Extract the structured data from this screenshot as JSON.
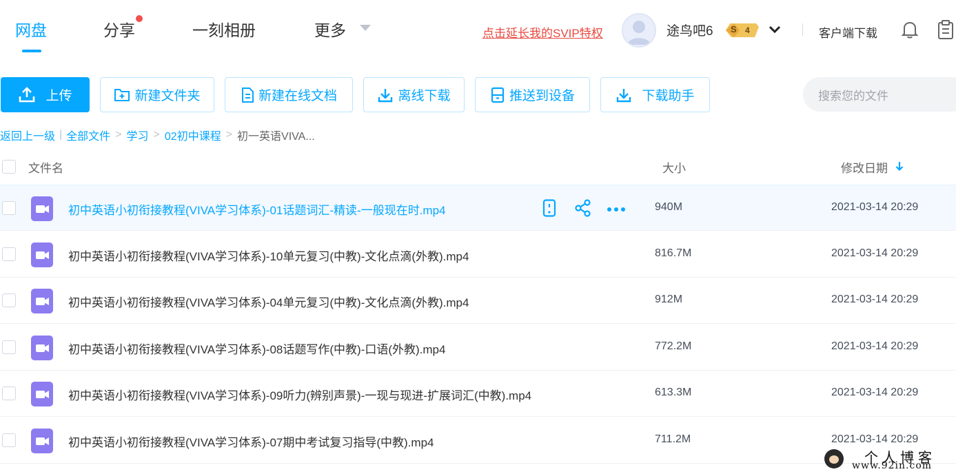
{
  "nav": {
    "tabs": [
      {
        "label": "网盘"
      },
      {
        "label": "分享"
      },
      {
        "label": "一刻相册"
      },
      {
        "label": "更多"
      }
    ]
  },
  "header": {
    "svip_link": "点击延长我的SVIP特权",
    "username": "途鸟吧6",
    "badge_letter": "S",
    "badge_level": "4",
    "client_download": "客户端下载"
  },
  "toolbar": {
    "upload": "上传",
    "new_folder": "新建文件夹",
    "new_doc": "新建在线文档",
    "offline_download": "离线下载",
    "push_device": "推送到设备",
    "download_helper": "下载助手"
  },
  "search": {
    "placeholder": "搜索您的文件"
  },
  "breadcrumb": {
    "back": "返回上一级",
    "items": [
      "全部文件",
      "学习",
      "02初中课程"
    ],
    "current": "初一英语VIVA..."
  },
  "columns": {
    "name": "文件名",
    "size": "大小",
    "date": "修改日期"
  },
  "files": [
    {
      "name": "初中英语小初衔接教程(VIVA学习体系)-01话题词汇-精读-一般现在时.mp4",
      "size": "940M",
      "date": "2021-03-14 20:29"
    },
    {
      "name": "初中英语小初衔接教程(VIVA学习体系)-10单元复习(中教)-文化点滴(外教).mp4",
      "size": "816.7M",
      "date": "2021-03-14 20:29"
    },
    {
      "name": "初中英语小初衔接教程(VIVA学习体系)-04单元复习(中教)-文化点滴(外教).mp4",
      "size": "912M",
      "date": "2021-03-14 20:29"
    },
    {
      "name": "初中英语小初衔接教程(VIVA学习体系)-08话题写作(中教)-口语(外教).mp4",
      "size": "772.2M",
      "date": "2021-03-14 20:29"
    },
    {
      "name": "初中英语小初衔接教程(VIVA学习体系)-09听力(辨别声景)-一现与现进-扩展词汇(中教).mp4",
      "size": "613.3M",
      "date": "2021-03-14 20:29"
    },
    {
      "name": "初中英语小初衔接教程(VIVA学习体系)-07期中考试复习指导(中教).mp4",
      "size": "711.2M",
      "date": "2021-03-14 20:29"
    }
  ],
  "watermark": {
    "title": "个人博客",
    "url": "www.92in.com"
  },
  "colors": {
    "accent": "#06a7ff",
    "svip_red": "#e8483f",
    "video_icon": "#8c7cf0",
    "notify_dot": "#f34f4f"
  },
  "icons": [
    "upload-icon",
    "new-folder-icon",
    "doc-icon",
    "download-icon",
    "device-icon",
    "bell-icon",
    "clipboard-icon",
    "video-file-icon",
    "phone-icon",
    "share-icon",
    "more-icon",
    "sort-down-icon",
    "chevron-down-icon"
  ]
}
